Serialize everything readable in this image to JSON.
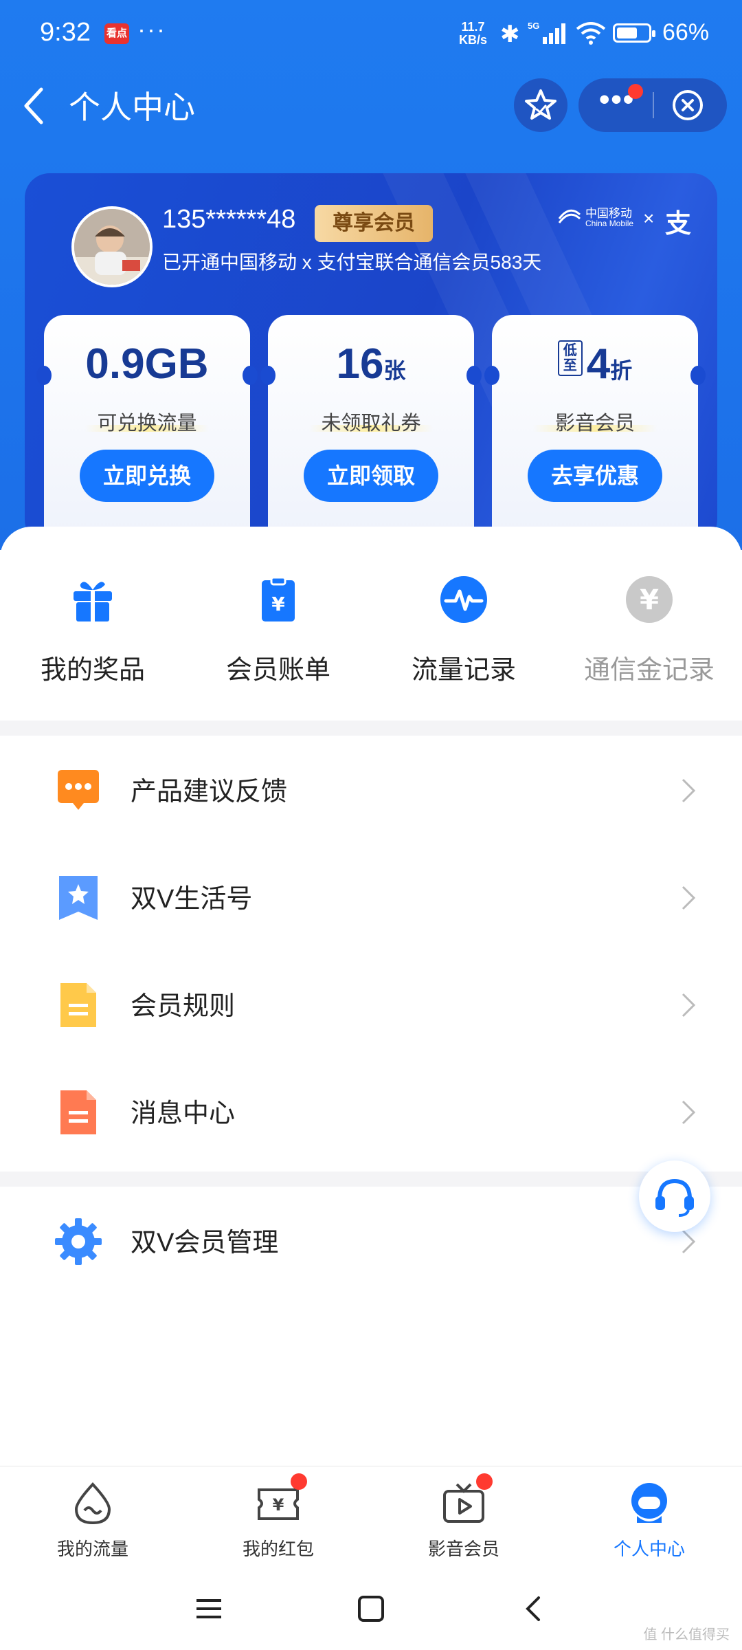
{
  "status": {
    "time": "9:32",
    "app_badge": "看点",
    "more": "···",
    "speed_value": "11.7",
    "speed_unit": "KB/s",
    "network": "5G",
    "battery_percent": 66,
    "battery_label": "66%"
  },
  "header": {
    "title": "个人中心"
  },
  "member": {
    "phone": "135******48",
    "badge": "尊享会员",
    "description": "已开通中国移动 x 支付宝联合通信会员583天",
    "partner_cn": "中国移动",
    "partner_en": "China Mobile",
    "partner_x": "×",
    "partner_alipay": "支"
  },
  "tickets": [
    {
      "value": "0.9GB",
      "unit": "",
      "prefix": "",
      "label": "可兑换流量",
      "button": "立即兑换"
    },
    {
      "value": "16",
      "unit": "张",
      "prefix": "",
      "label": "未领取礼券",
      "button": "立即领取"
    },
    {
      "value": "4",
      "unit": "折",
      "prefix": "低至",
      "label": "影音会员",
      "button": "去享优惠"
    }
  ],
  "quick_actions": [
    {
      "label": "我的奖品",
      "icon": "gift-icon"
    },
    {
      "label": "会员账单",
      "icon": "bill-icon"
    },
    {
      "label": "流量记录",
      "icon": "pulse-icon"
    },
    {
      "label": "通信金记录",
      "icon": "yuan-icon"
    }
  ],
  "menu": [
    {
      "label": "产品建议反馈",
      "icon": "feedback-icon"
    },
    {
      "label": "双V生活号",
      "icon": "bookmark-star-icon"
    },
    {
      "label": "会员规则",
      "icon": "document-icon"
    },
    {
      "label": "消息中心",
      "icon": "message-doc-icon"
    },
    {
      "label": "双V会员管理",
      "icon": "gear-icon"
    }
  ],
  "tabs": [
    {
      "label": "我的流量",
      "icon": "flow-icon",
      "active": false,
      "dot": false
    },
    {
      "label": "我的红包",
      "icon": "red-packet-icon",
      "active": false,
      "dot": true
    },
    {
      "label": "影音会员",
      "icon": "tv-play-icon",
      "active": false,
      "dot": true
    },
    {
      "label": "个人中心",
      "icon": "person-icon",
      "active": true,
      "dot": false
    }
  ],
  "watermark": "值 什么值得买",
  "colors": {
    "primary": "#1677ff",
    "header_bg": "#1f7bf0",
    "card_bg": "#1a4fd6",
    "badge_gold": "#e6b46a",
    "red_dot": "#ff3a30"
  }
}
